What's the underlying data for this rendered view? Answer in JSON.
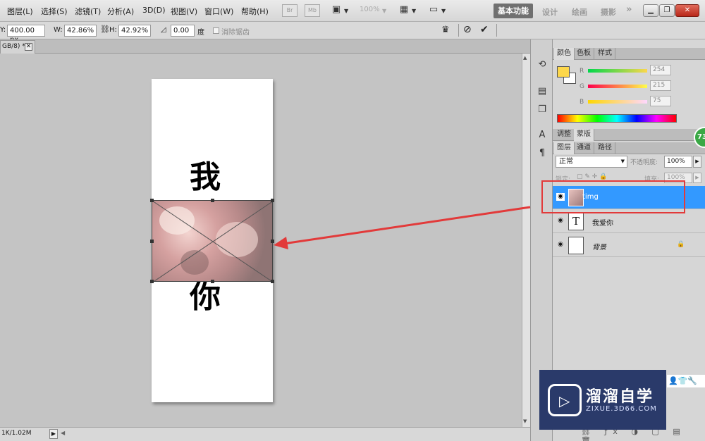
{
  "menu": {
    "items": [
      "图层(L)",
      "选择(S)",
      "滤镜(T)",
      "分析(A)",
      "3D(D)",
      "视图(V)",
      "窗口(W)",
      "帮助(H)"
    ],
    "zoom": "100%",
    "br": "Br",
    "mb": "Mb"
  },
  "workspace": {
    "active": "基本功能",
    "items": [
      "设计",
      "绘画",
      "摄影"
    ],
    "more": "»"
  },
  "options": {
    "y_label": "Y:",
    "y_value": "400.00 px",
    "w_label": "W:",
    "w_value": "42.86%",
    "h_label": "H:",
    "h_value": "42.92%",
    "angle_value": "0.00",
    "angle_unit": "度",
    "interp_label": "消除锯齿"
  },
  "document": {
    "tab_title": "GB/8) *",
    "status": "1K/1.02M",
    "text_top": "我",
    "text_bottom": "你"
  },
  "panels": {
    "color_tabs": [
      "颜色",
      "色板",
      "样式"
    ],
    "r_label": "R",
    "g_label": "G",
    "b_label": "B",
    "r": "254",
    "g": "215",
    "b": "75",
    "adjust_tabs": [
      "调整",
      "蒙版"
    ],
    "layer_tabs": [
      "图层",
      "通道",
      "路径"
    ],
    "blend_mode": "正常",
    "opacity_label": "不透明度:",
    "opacity": "100%",
    "lock_label": "锁定:",
    "fill_label": "填充:",
    "fill": "100%",
    "layers": [
      {
        "name": "timg",
        "type": "image"
      },
      {
        "name": "我爱你",
        "type": "text",
        "thumb": "T"
      },
      {
        "name": "背景",
        "type": "background"
      }
    ]
  },
  "colors": {
    "foreground": "#fdd74b",
    "highlight": "#3399ff",
    "annotation": "#e23a3a"
  },
  "watermark": {
    "title": "溜溜自学",
    "url": "ZIXUE.3D66.COM"
  },
  "badge": "73"
}
